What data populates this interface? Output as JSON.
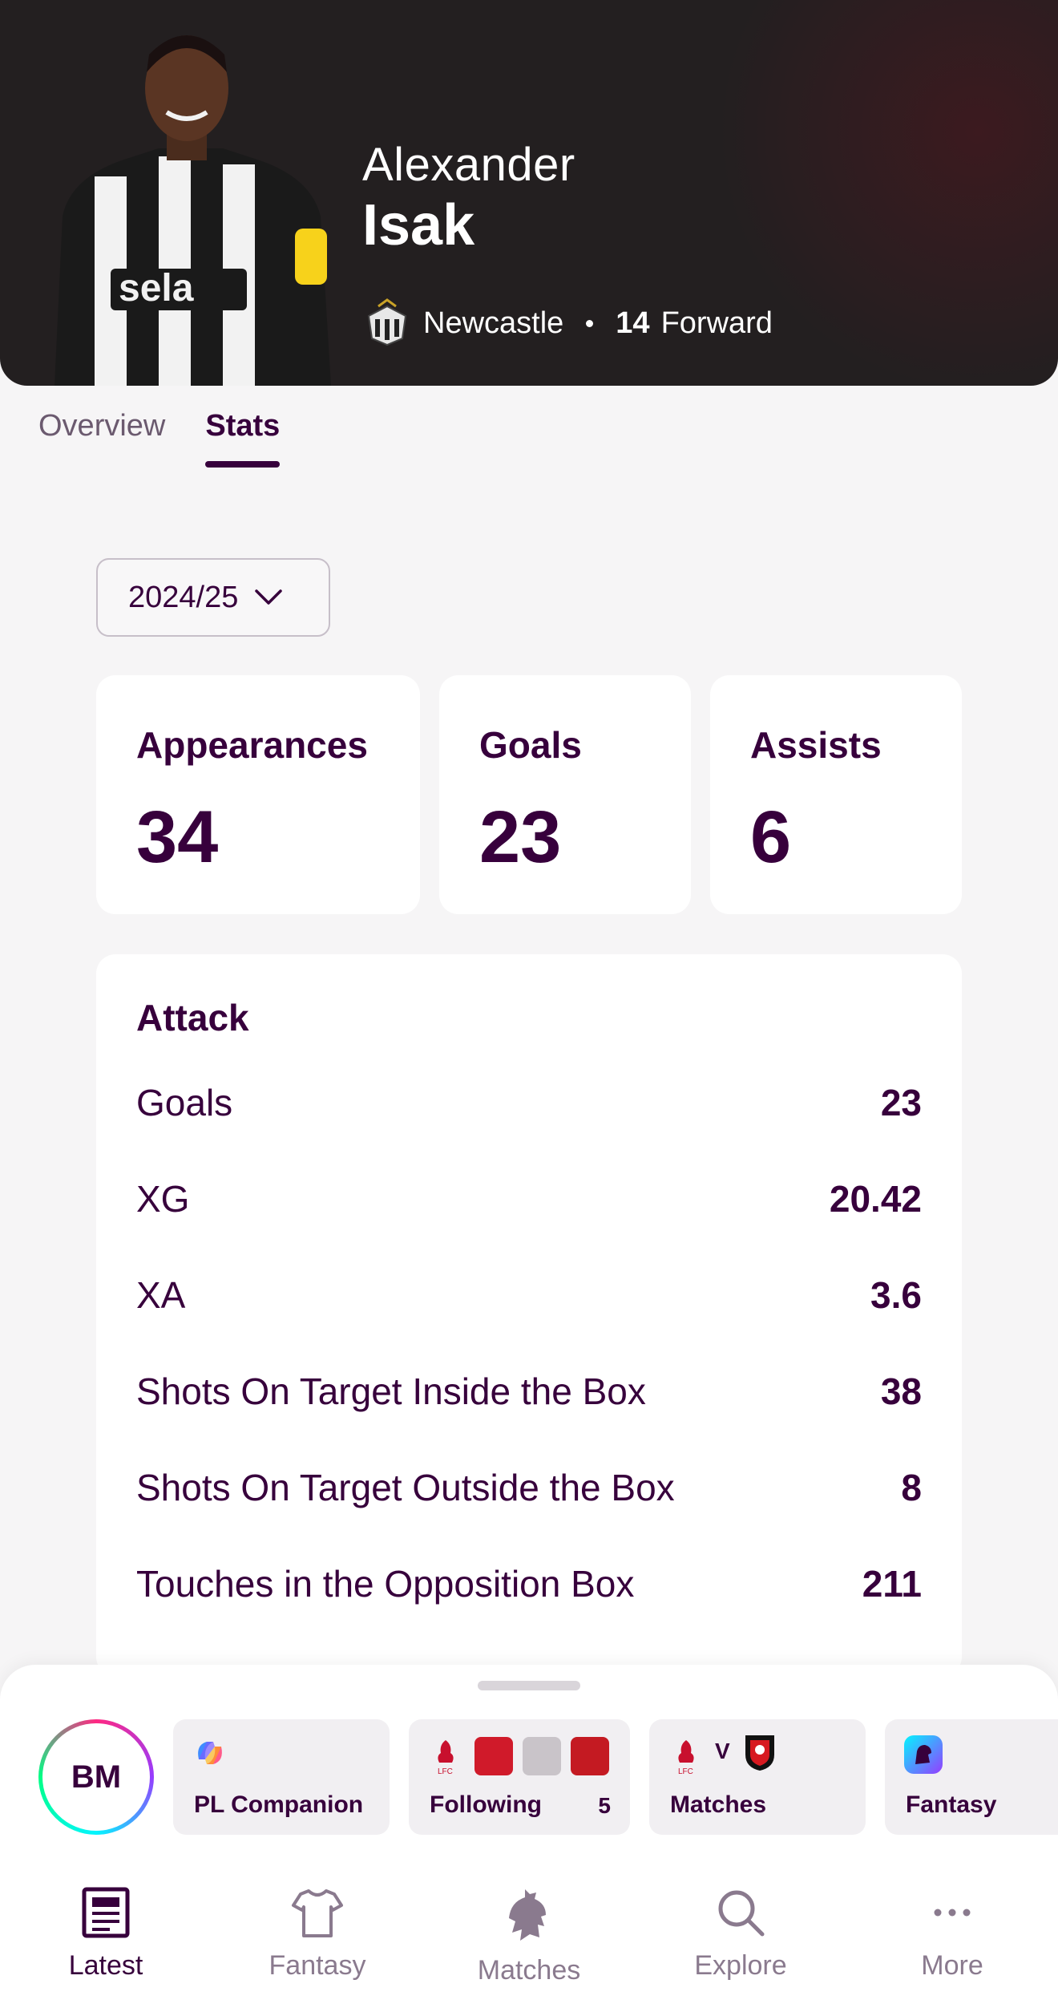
{
  "player": {
    "first_name": "Alexander",
    "last_name": "Isak",
    "club": "Newcastle",
    "shirt_number": "14",
    "position": "Forward"
  },
  "tabs": [
    {
      "label": "Overview",
      "active": false
    },
    {
      "label": "Stats",
      "active": true
    }
  ],
  "season": {
    "selected": "2024/25"
  },
  "summary": [
    {
      "label": "Appearances",
      "value": "34"
    },
    {
      "label": "Goals",
      "value": "23"
    },
    {
      "label": "Assists",
      "value": "6"
    }
  ],
  "attack": {
    "title": "Attack",
    "rows": [
      {
        "label": "Goals",
        "value": "23"
      },
      {
        "label": "XG",
        "value": "20.42"
      },
      {
        "label": "XA",
        "value": "3.6"
      },
      {
        "label": "Shots On Target Inside the Box",
        "value": "38"
      },
      {
        "label": "Shots On Target Outside the Box",
        "value": "8"
      },
      {
        "label": "Touches in the Opposition Box",
        "value": "211"
      }
    ]
  },
  "quick": {
    "avatar_initials": "BM",
    "chips": [
      {
        "label": "PL Companion",
        "icon": "copilot-icon"
      },
      {
        "label": "Following",
        "count": "5",
        "icon": "liverpool-crest-icon"
      },
      {
        "label": "Matches",
        "fixture_sep": "V",
        "icon": "liverpool-vs-bournemouth-icon"
      },
      {
        "label": "Fantasy",
        "icon": "premier-league-lion-icon"
      }
    ]
  },
  "nav": [
    {
      "label": "Latest",
      "icon": "news-icon",
      "active": true
    },
    {
      "label": "Fantasy",
      "icon": "shirt-icon",
      "active": false
    },
    {
      "label": "Matches",
      "icon": "lion-icon",
      "active": false
    },
    {
      "label": "Explore",
      "icon": "search-icon",
      "active": false
    },
    {
      "label": "More",
      "icon": "more-dots-icon",
      "active": false
    }
  ],
  "colors": {
    "primary": "#37003c",
    "header_bg": "#231f20",
    "page_bg": "#f6f5f6"
  }
}
